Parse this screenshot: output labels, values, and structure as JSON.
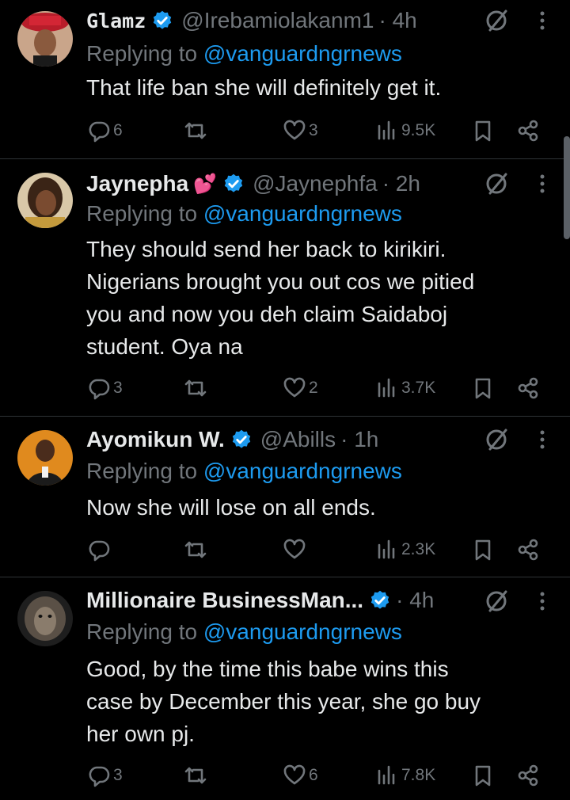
{
  "replying_label": "Replying to",
  "tweets": [
    {
      "name": "Glamz",
      "name_emoji": "",
      "handle": "@Irebamiolakanm1",
      "time": "· 4h",
      "reply_to": "@vanguardngrnews",
      "text": "That life ban she will definitely get it.",
      "replies": "6",
      "retweets": "",
      "likes": "3",
      "views": "9.5K"
    },
    {
      "name": "Jaynepha",
      "name_emoji": "💕",
      "handle": "@Jaynephfa",
      "time": "· 2h",
      "reply_to": "@vanguardngrnews",
      "text": "They should send her back to kirikiri.\nNigerians brought you out cos we pitied\nyou and now you deh claim Saidaboj\nstudent. Oya na",
      "replies": "3",
      "retweets": "",
      "likes": "2",
      "views": "3.7K"
    },
    {
      "name": "Ayomikun W.",
      "name_emoji": "",
      "handle": "@Abills",
      "time": "· 1h",
      "reply_to": "@vanguardngrnews",
      "text": "Now she will lose on all ends.",
      "replies": "",
      "retweets": "",
      "likes": "",
      "views": "2.3K"
    },
    {
      "name": "Millionaire BusinessMan...",
      "name_emoji": "",
      "handle": "",
      "time": "· 4h",
      "reply_to": "@vanguardngrnews",
      "text": "Good, by the time this babe wins this\ncase by December this year, she go buy\nher own pj.",
      "replies": "3",
      "retweets": "",
      "likes": "6",
      "views": "7.8K"
    }
  ],
  "colors": {
    "background": "#000000",
    "text": "#e7e9ea",
    "muted": "#71767b",
    "link": "#1d9bf0",
    "verified": "#1d9bf0",
    "divider": "#2f3336"
  },
  "icons": [
    "verified-badge-icon",
    "grok-icon",
    "more-icon",
    "reply-icon",
    "retweet-icon",
    "like-icon",
    "views-icon",
    "bookmark-icon",
    "share-icon"
  ]
}
